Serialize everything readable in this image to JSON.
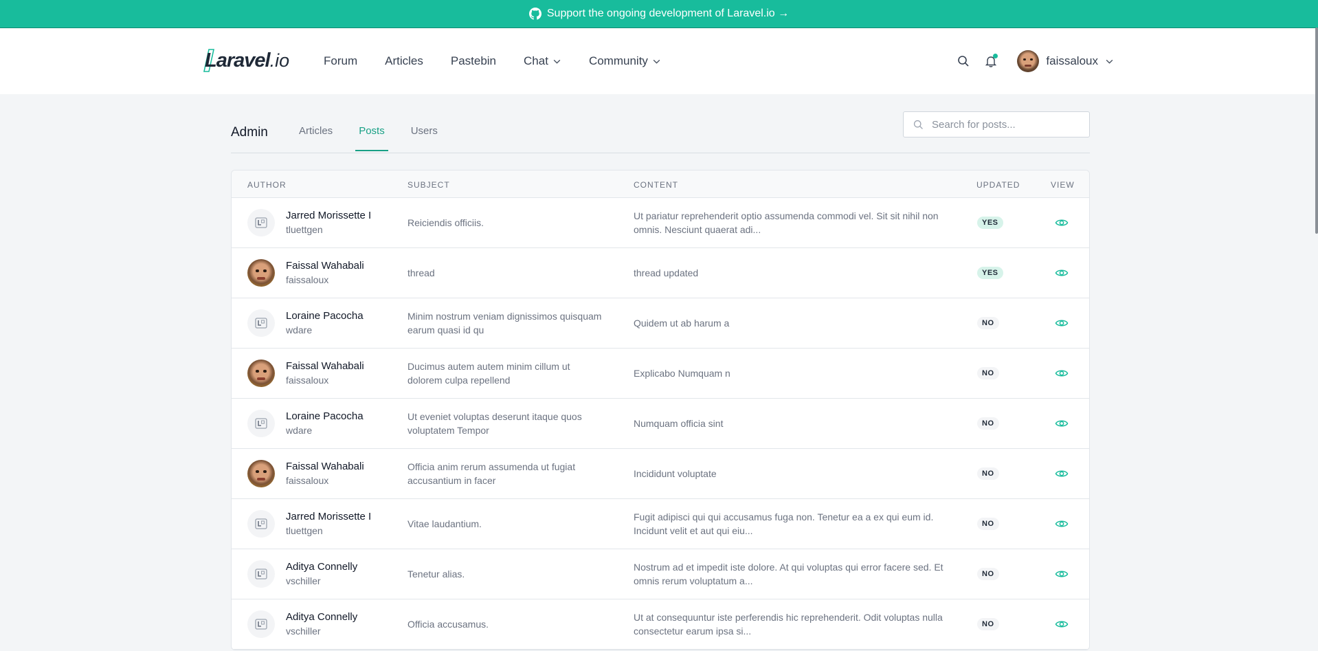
{
  "banner": {
    "text": "Support the ongoing development of Laravel.io →"
  },
  "logo": {
    "word": "Laravel",
    "suffix": ".io"
  },
  "nav": {
    "items": [
      {
        "label": "Forum"
      },
      {
        "label": "Articles"
      },
      {
        "label": "Pastebin"
      },
      {
        "label": "Chat",
        "dropdown": true
      },
      {
        "label": "Community",
        "dropdown": true
      }
    ],
    "username": "faissaloux"
  },
  "admin": {
    "title": "Admin",
    "tabs": [
      {
        "label": "Articles",
        "active": false
      },
      {
        "label": "Posts",
        "active": true
      },
      {
        "label": "Users",
        "active": false
      }
    ],
    "search_placeholder": "Search for posts..."
  },
  "table": {
    "headers": [
      "AUTHOR",
      "SUBJECT",
      "CONTENT",
      "UPDATED",
      "VIEW"
    ],
    "rows": [
      {
        "name": "Jarred Morissette I",
        "username": "tluettgen",
        "avatar": "default",
        "subject": "Reiciendis officiis.",
        "content": "Ut pariatur reprehenderit optio assumenda commodi vel. Sit sit nihil non omnis. Nesciunt quaerat adi...",
        "updated": "YES"
      },
      {
        "name": "Faissal Wahabali",
        "username": "faissaloux",
        "avatar": "photo",
        "subject": "thread",
        "content": "thread updated",
        "updated": "YES"
      },
      {
        "name": "Loraine Pacocha",
        "username": "wdare",
        "avatar": "default",
        "subject": "Minim nostrum veniam dignissimos quisquam earum quasi id qu",
        "content": "Quidem ut ab harum a",
        "updated": "NO"
      },
      {
        "name": "Faissal Wahabali",
        "username": "faissaloux",
        "avatar": "photo",
        "subject": "Ducimus autem autem minim cillum ut dolorem culpa repellend",
        "content": "Explicabo Numquam n",
        "updated": "NO"
      },
      {
        "name": "Loraine Pacocha",
        "username": "wdare",
        "avatar": "default",
        "subject": "Ut eveniet voluptas deserunt itaque quos voluptatem Tempor",
        "content": "Numquam officia sint",
        "updated": "NO"
      },
      {
        "name": "Faissal Wahabali",
        "username": "faissaloux",
        "avatar": "photo",
        "subject": "Officia anim rerum assumenda ut fugiat accusantium in facer",
        "content": "Incididunt voluptate",
        "updated": "NO"
      },
      {
        "name": "Jarred Morissette I",
        "username": "tluettgen",
        "avatar": "default",
        "subject": "Vitae laudantium.",
        "content": "Fugit adipisci qui qui accusamus fuga non. Tenetur ea a ex qui eum id. Incidunt velit et aut qui eiu...",
        "updated": "NO"
      },
      {
        "name": "Aditya Connelly",
        "username": "vschiller",
        "avatar": "default",
        "subject": "Tenetur alias.",
        "content": "Nostrum ad et impedit iste dolore. At qui voluptas qui error facere sed. Et omnis rerum voluptatum a...",
        "updated": "NO"
      },
      {
        "name": "Aditya Connelly",
        "username": "vschiller",
        "avatar": "default",
        "subject": "Officia accusamus.",
        "content": "Ut at consequuntur iste perferendis hic reprehenderit. Odit voluptas nulla consectetur earum ipsa si...",
        "updated": "NO"
      }
    ]
  },
  "colors": {
    "accent": "#18bc9c",
    "accent_dark": "#18a085"
  },
  "icons": {
    "banner": "github-icon",
    "search": "search-icon",
    "notifications": "bell-icon",
    "view": "eye-icon"
  }
}
